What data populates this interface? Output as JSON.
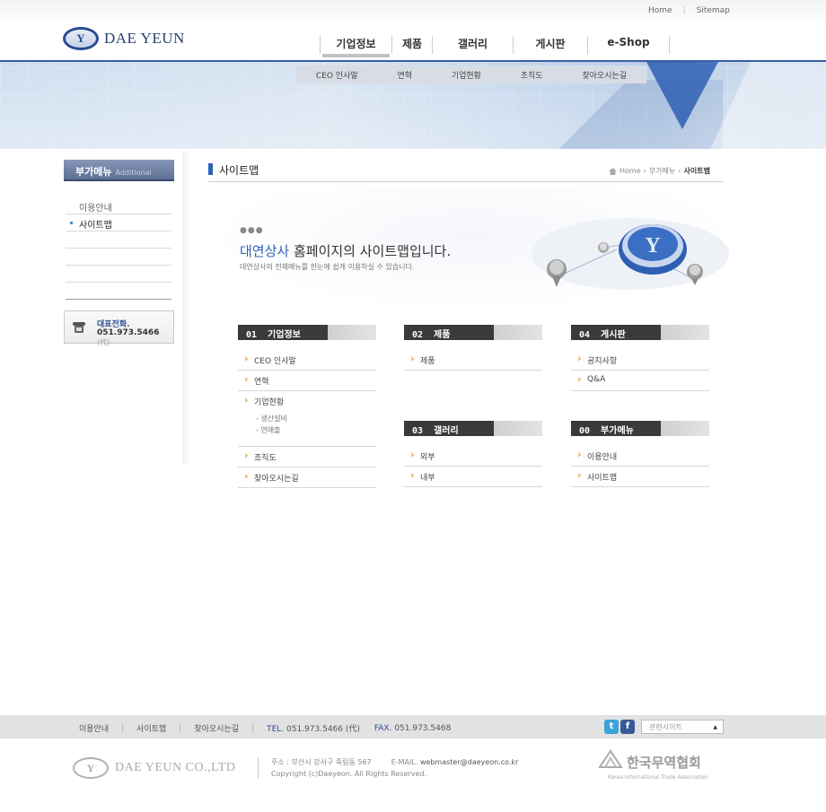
{
  "util": {
    "home": "Home",
    "separator": "|",
    "sitemap": "Sitemap"
  },
  "brand": {
    "logo_mark": "Y",
    "name": "DAE YEUN"
  },
  "gnb": [
    {
      "label": "기업정보",
      "active": true,
      "width": 80
    },
    {
      "label": "제품",
      "active": false,
      "width": 45
    },
    {
      "label": "갤러리",
      "active": false,
      "width": 90
    },
    {
      "label": "게시판",
      "active": false,
      "width": 83
    },
    {
      "label": "e-Shop",
      "active": false,
      "width": 92
    }
  ],
  "snb": [
    "CEO 인사말",
    "연혁",
    "기업현황",
    "조직도",
    "찾아오시는길"
  ],
  "lnb": {
    "title": "부가메뉴",
    "title_sub": "Additional",
    "items": [
      "이용안내",
      "사이트맵"
    ],
    "active_index": 1
  },
  "tel_box": {
    "label": "대표전화.",
    "number": "051.973.5466",
    "suffix": "(代)"
  },
  "page": {
    "title": "사이트맵",
    "breadcrumb": [
      "Home",
      "부가메뉴",
      "사이트맵"
    ]
  },
  "intro": {
    "dots": "●●●",
    "headline_accent": "대연상사",
    "headline_rest": " 홈페이지의 사이트맵입니다.",
    "description": "대연상사의 전체메뉴를 한눈에 쉽게 이용하실 수 있습니다."
  },
  "sitemap": [
    {
      "num": "01",
      "title": "기업정보",
      "items": [
        "CEO 인사말",
        "연혁",
        "기업현황",
        "조직도",
        "찾아오시는길"
      ],
      "subitems": {
        "2": [
          "- 생산설비",
          "- 연매출"
        ]
      }
    },
    {
      "num": "02",
      "title": "제품",
      "items": [
        "제품"
      ]
    },
    {
      "num": "03",
      "title": "갤러리",
      "items": [
        "외부",
        "내부"
      ]
    },
    {
      "num": "04",
      "title": "게시판",
      "items": [
        "공지사항",
        "Q&A"
      ]
    },
    {
      "num": "00",
      "title": "부가메뉴",
      "items": [
        "이용안내",
        "사이트맵"
      ]
    }
  ],
  "footer": {
    "nav": [
      "이용안내",
      "사이트맵",
      "찾아오시는길"
    ],
    "tel_label": "TEL.",
    "tel": "051.973.5466 (代)",
    "fax_label": "FAX.",
    "fax": "051.973.5468",
    "related_site": "관련사이트",
    "company": "DAE YEUN CO.,LTD",
    "address": "주소 : 부산시 강서구 죽림동 567",
    "email_label": "E-MAIL.",
    "email": "webmaster@daeyeon.co.kr",
    "copyright": "Copyright (c)Daeyeon. All Rights Reserved.",
    "association": "한국무역협회",
    "association_en": "Korea International Trade Association"
  },
  "colors": {
    "brand_blue": "#2a4d8f",
    "accent_blue": "#2e62b8",
    "bullet_orange": "#e3a02a",
    "dark_header": "#3a3a3a"
  }
}
